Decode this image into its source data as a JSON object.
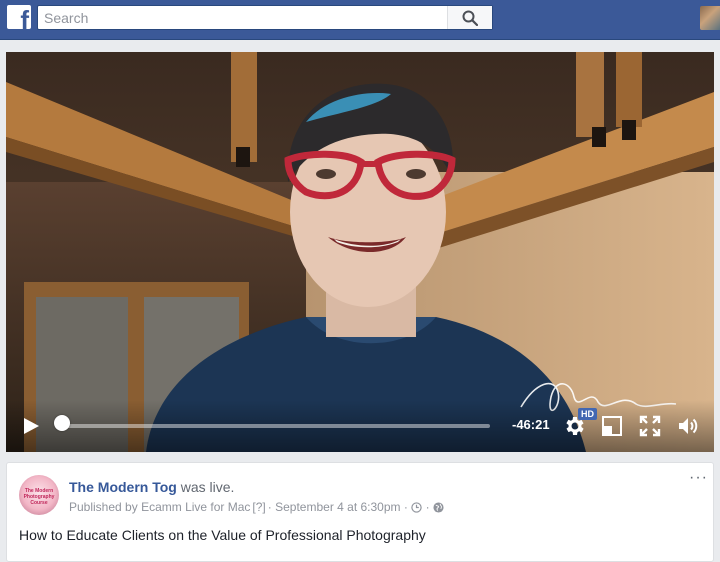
{
  "topbar": {
    "logo_letter": "f",
    "search_placeholder": "Search",
    "search_value": "",
    "brand_color": "#3b5998"
  },
  "video": {
    "time_remaining": "-46:21",
    "hd_label": "HD",
    "progress_fraction": 0.0,
    "controls": [
      "play-icon",
      "gear-icon",
      "pop-out-icon",
      "fullscreen-icon",
      "volume-icon"
    ]
  },
  "post": {
    "page_name": "The Modern Tog",
    "action_text": "was live.",
    "published_prefix": "Published by",
    "publisher": "Ecamm Live for Mac",
    "help_marker": "[?]",
    "separator": "·",
    "date": "September 4 at 6:30pm",
    "avatar_text": "The Modern Photography Course",
    "more_label": "···",
    "body": "How to Educate Clients on the Value of Professional Photography",
    "link_color": "#365899"
  }
}
